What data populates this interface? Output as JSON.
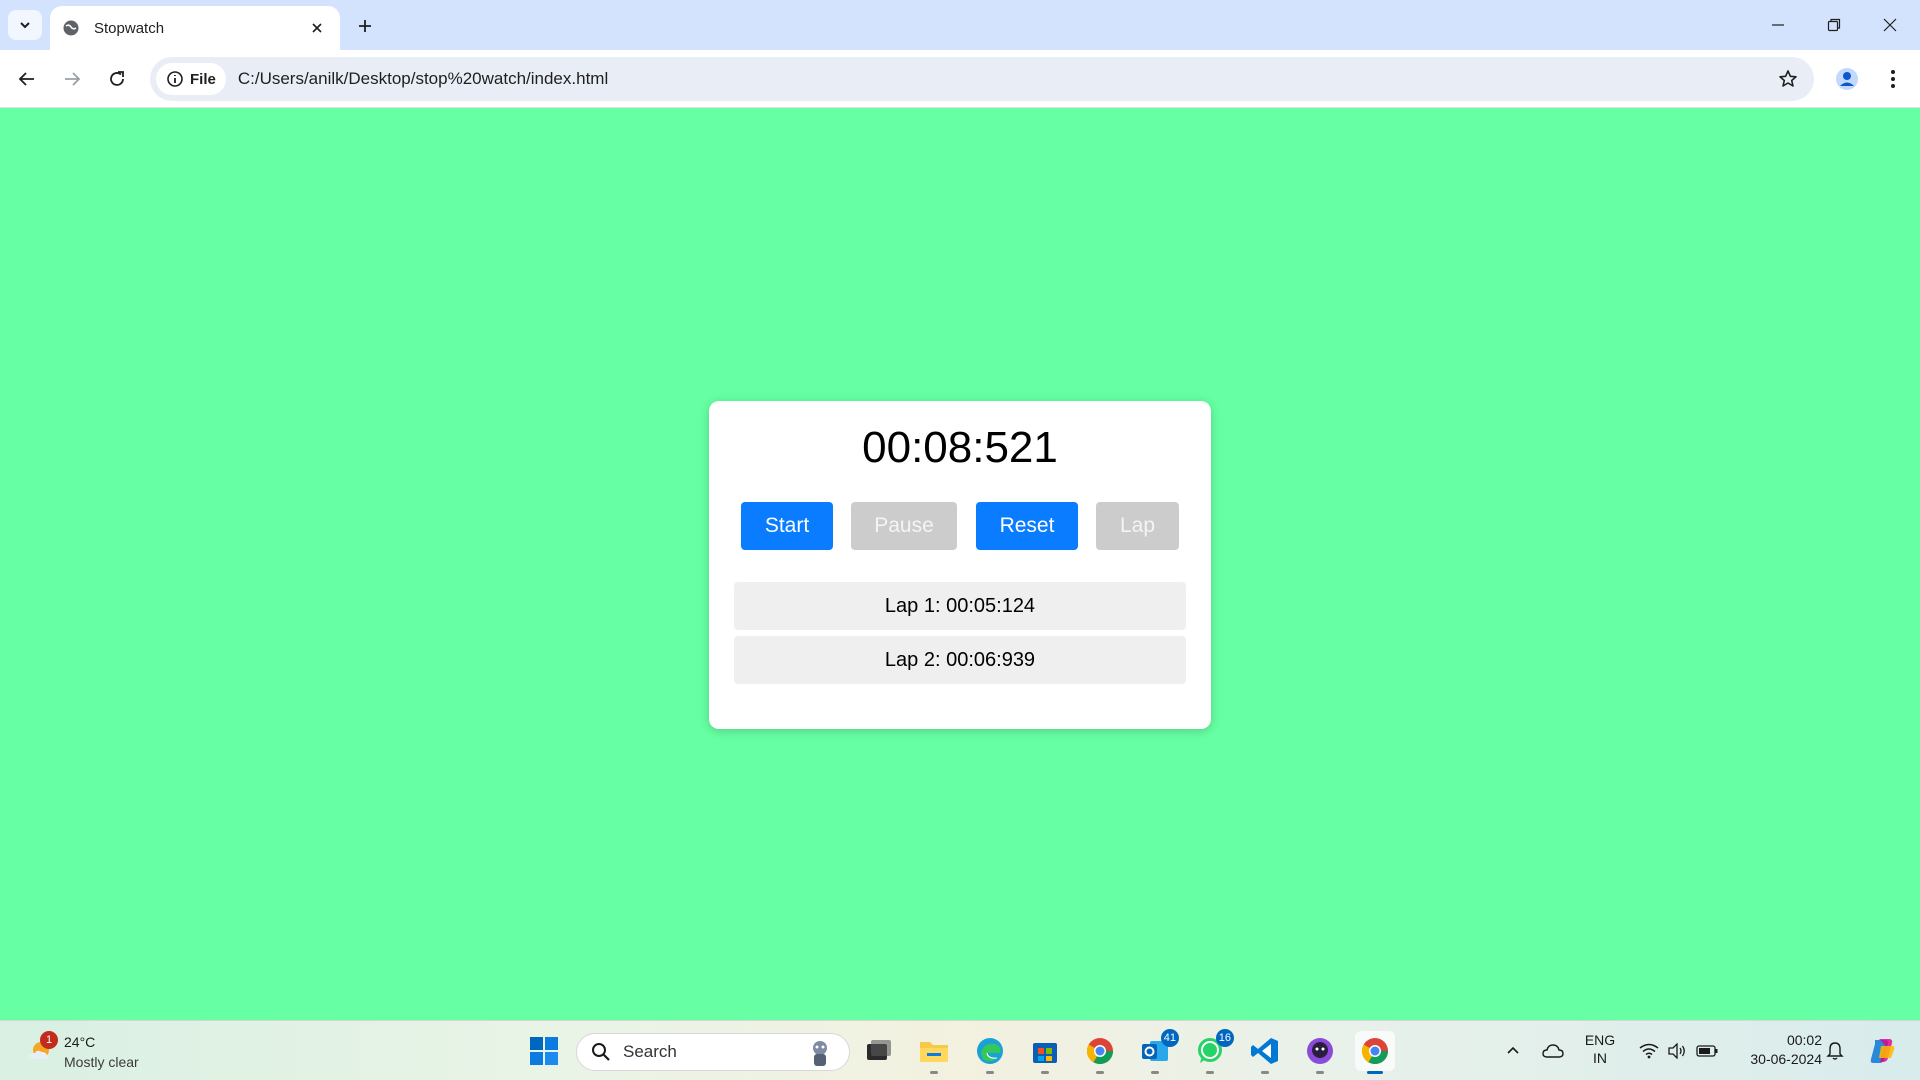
{
  "browser": {
    "tab_title": "Stopwatch",
    "site_chip_label": "File",
    "url": "C:/Users/anilk/Desktop/stop%20watch/index.html"
  },
  "stopwatch": {
    "time": "00:08:521",
    "buttons": {
      "start": "Start",
      "pause": "Pause",
      "reset": "Reset",
      "lap": "Lap"
    },
    "laps": [
      "Lap 1: 00:05:124",
      "Lap 2: 00:06:939"
    ]
  },
  "taskbar": {
    "weather": {
      "temperature": "24°C",
      "condition": "Mostly clear",
      "badge": "1"
    },
    "search_label": "Search",
    "badges": {
      "outlook": "41",
      "whatsapp": "16"
    },
    "language": {
      "line1": "ENG",
      "line2": "IN"
    },
    "clock": {
      "time": "00:02",
      "date": "30-06-2024"
    }
  },
  "colors": {
    "page_background": "#66ffa3",
    "primary_button": "#0a7cff",
    "disabled_button": "#cccccc",
    "lap_background": "#efefef"
  }
}
